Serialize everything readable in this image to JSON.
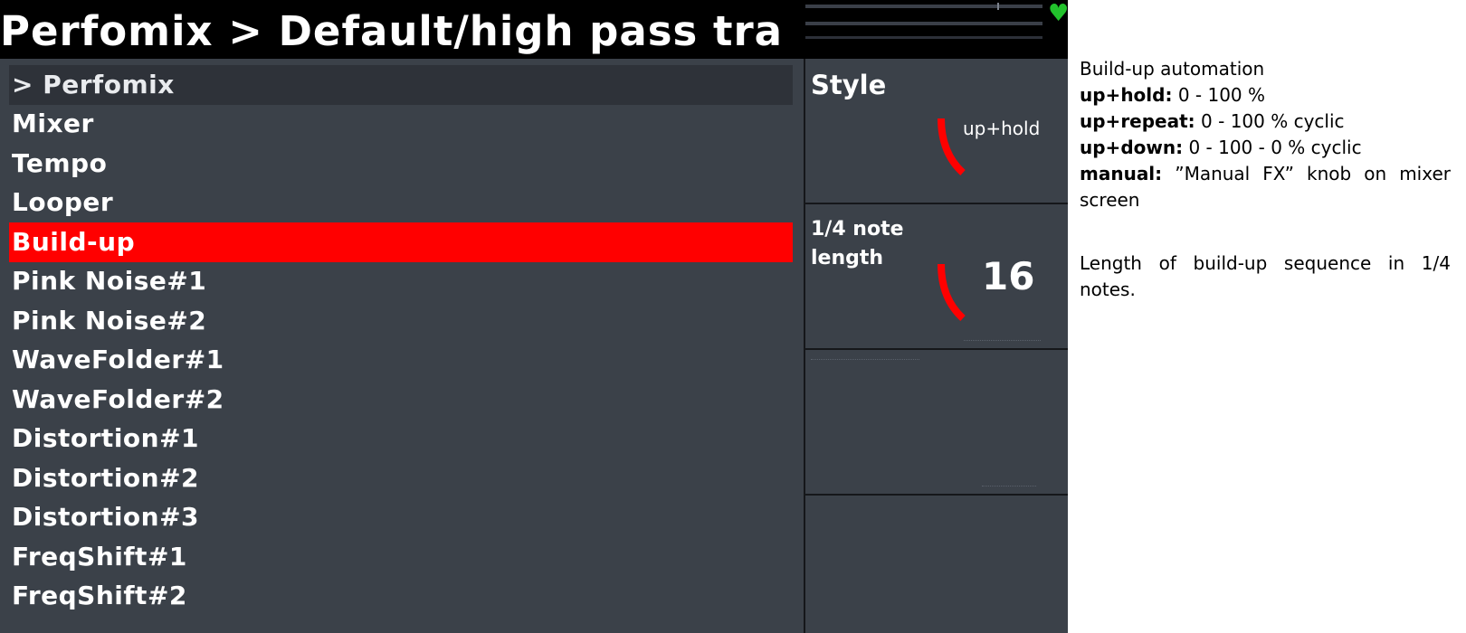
{
  "title": "Perfomix > Default/high pass tra",
  "menu": {
    "items": [
      {
        "label": "> Perfomix",
        "state": "header"
      },
      {
        "label": "Mixer",
        "state": "normal"
      },
      {
        "label": "Tempo",
        "state": "normal"
      },
      {
        "label": "Looper",
        "state": "normal"
      },
      {
        "label": "Build-up",
        "state": "selected"
      },
      {
        "label": "Pink Noise#1",
        "state": "normal"
      },
      {
        "label": "Pink Noise#2",
        "state": "normal"
      },
      {
        "label": "WaveFolder#1",
        "state": "normal"
      },
      {
        "label": "WaveFolder#2",
        "state": "normal"
      },
      {
        "label": "Distortion#1",
        "state": "normal"
      },
      {
        "label": "Distortion#2",
        "state": "normal"
      },
      {
        "label": "Distortion#3",
        "state": "normal"
      },
      {
        "label": "FreqShift#1",
        "state": "normal"
      },
      {
        "label": "FreqShift#2",
        "state": "normal"
      }
    ]
  },
  "params": {
    "style": {
      "label": "Style",
      "value": "up+hold"
    },
    "length": {
      "label_line1": "1/4 note",
      "label_line2": "length",
      "value": "16"
    }
  },
  "help": {
    "style": {
      "heading": "Build-up automation",
      "options": [
        {
          "key": "up+hold:",
          "desc": "0 - 100 %"
        },
        {
          "key": "up+repeat:",
          "desc": "0 - 100 % cyclic"
        },
        {
          "key": "up+down:",
          "desc": "0 - 100 - 0 % cyclic"
        },
        {
          "key": "manual:",
          "desc": "”Manual FX” knob on mixer screen"
        }
      ]
    },
    "length": "Length of build-up sequence in 1/4 notes."
  },
  "colors": {
    "accent": "#ff0000",
    "panel_bg": "#3b4149",
    "header_bg": "#2e3239",
    "heart": "#22c22c"
  },
  "icons": {
    "status": "heart-icon"
  }
}
